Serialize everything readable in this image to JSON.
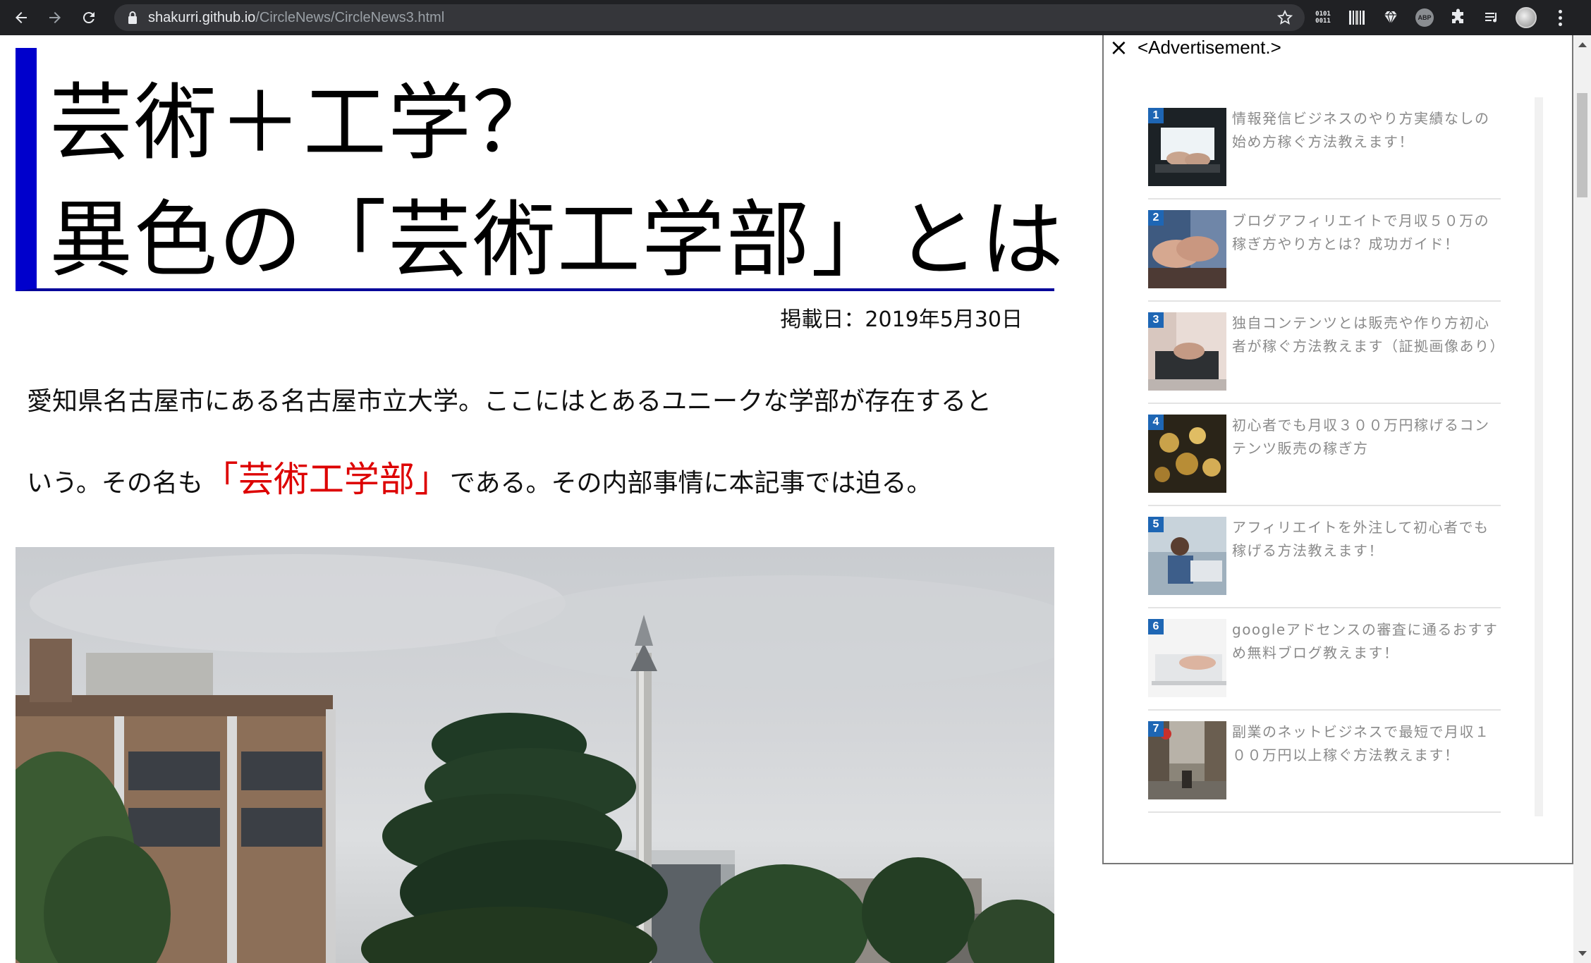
{
  "browser": {
    "url_host": "shakurri.github.io",
    "url_path": "/CircleNews/CircleNews3.html",
    "extensions": {
      "binary_label_top": "0101",
      "binary_label_bottom": "0011",
      "adblock_label": "ABP"
    }
  },
  "article": {
    "title_line1": "芸術＋工学？",
    "title_line2": "異色の「芸術工学部」とは",
    "publish_date": "掲載日：2019年5月30日",
    "lead_line1": "愛知県名古屋市にある名古屋市立大学。ここにはとあるユニークな学部が存在すると",
    "lead_line2_before": "いう。その名も",
    "lead_highlight": "「芸術工学部」",
    "lead_line2_after": "である。その内部事情に本記事では迫る。",
    "highlight_color": "#dd0000",
    "accent_color": "#0000cc"
  },
  "advertisement": {
    "close_symbol": "×",
    "label": "<Advertisement.>",
    "items": [
      {
        "num": "1",
        "text": "情報発信ビジネスのやり方実績なしの始め方稼ぐ方法教えます！",
        "thumb": "laptop-hands-thumb"
      },
      {
        "num": "2",
        "text": "ブログアフィリエイトで月収５０万の稼ぎ方やり方とは？成功ガイド！",
        "thumb": "handshake-thumb"
      },
      {
        "num": "3",
        "text": "独自コンテンツとは販売や作り方初心者が稼ぐ方法教えます（証拠画像あり）",
        "thumb": "typing-thumb"
      },
      {
        "num": "4",
        "text": "初心者でも月収３００万円稼げるコンテンツ販売の稼ぎ方",
        "thumb": "coins-thumb"
      },
      {
        "num": "5",
        "text": "アフィリエイトを外注して初心者でも稼げる方法教えます！",
        "thumb": "office-worker-thumb"
      },
      {
        "num": "6",
        "text": "googleアドセンスの審査に通るおすすめ無料ブログ教えます！",
        "thumb": "laptop-white-thumb"
      },
      {
        "num": "7",
        "text": "副業のネットビジネスで最短で月収１００万円以上稼ぐ方法教えます！",
        "thumb": "city-street-thumb"
      }
    ]
  }
}
